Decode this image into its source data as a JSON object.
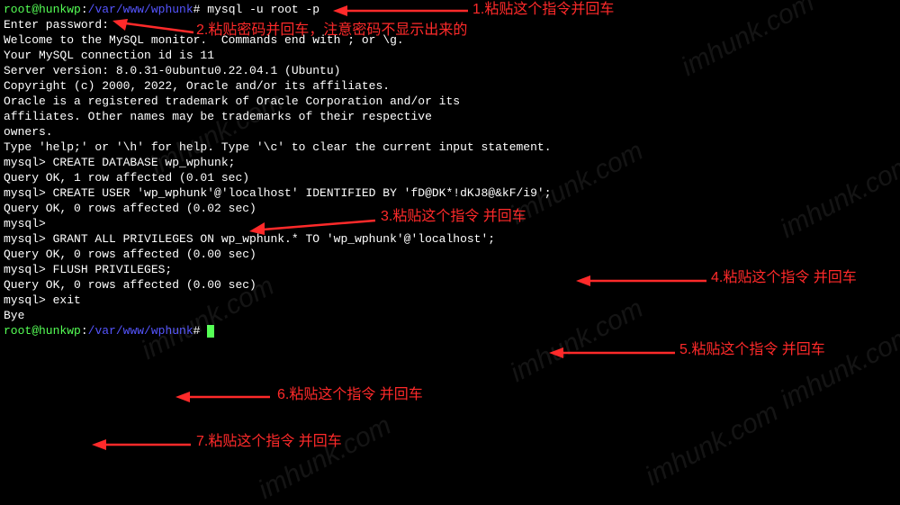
{
  "terminal": {
    "prompt_user": "root@hunkwp",
    "prompt_sep": ":",
    "prompt_path": "/var/www/wphunk",
    "prompt_end": "#",
    "cmd1": " mysql -u root -p",
    "line2": "Enter password:",
    "line3": "Welcome to the MySQL monitor.  Commands end with ; or \\g.",
    "line4": "Your MySQL connection id is 11",
    "line5": "Server version: 8.0.31-0ubuntu0.22.04.1 (Ubuntu)",
    "line6": "",
    "line7": "Copyright (c) 2000, 2022, Oracle and/or its affiliates.",
    "line8": "",
    "line9": "Oracle is a registered trademark of Oracle Corporation and/or its",
    "line10": "affiliates. Other names may be trademarks of their respective",
    "line11": "owners.",
    "line12": "",
    "line13": "Type 'help;' or '\\h' for help. Type '\\c' to clear the current input statement.",
    "line14": "",
    "line15": "mysql> CREATE DATABASE wp_wphunk;",
    "line16": "Query OK, 1 row affected (0.01 sec)",
    "line17": "",
    "line18": "mysql> CREATE USER 'wp_wphunk'@'localhost' IDENTIFIED BY 'fD@DK*!dKJ8@&kF/i9';",
    "line19": "Query OK, 0 rows affected (0.02 sec)",
    "line20": "",
    "line21": "mysql>",
    "line22": "mysql> GRANT ALL PRIVILEGES ON wp_wphunk.* TO 'wp_wphunk'@'localhost';",
    "line23": "Query OK, 0 rows affected (0.00 sec)",
    "line24": "",
    "line25": "mysql> FLUSH PRIVILEGES;",
    "line26": "Query OK, 0 rows affected (0.00 sec)",
    "line27": "",
    "line28": "mysql> exit",
    "line29": "Bye",
    "cmd2": " "
  },
  "annotations": {
    "a1": "1.粘贴这个指令并回车",
    "a2": "2.粘贴密码并回车，注意密码不显示出来的",
    "a3": "3.粘贴这个指令 并回车",
    "a4": "4.粘贴这个指令 并回车",
    "a5": "5.粘贴这个指令 并回车",
    "a6": "6.粘贴这个指令 并回车",
    "a7": "7.粘贴这个指令 并回车"
  },
  "watermark": "imhunk.com"
}
